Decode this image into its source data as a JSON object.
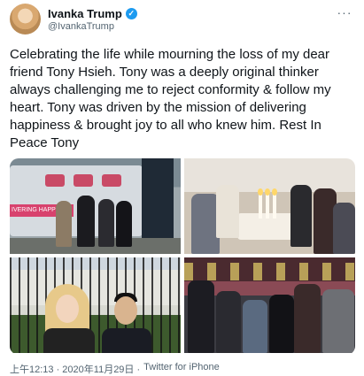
{
  "tweet": {
    "display_name": "Ivanka Trump",
    "verified_mark": "✓",
    "handle": "@IvankaTrump",
    "more_icon": "more-horizontal-icon",
    "text": "Celebrating the life while mourning the loss of my dear friend Tony Hsieh. Tony was a deeply original thinker always challenging me to reject conformity & follow my heart. Tony was driven by the mission of delivering happiness & brought joy to all who knew him. Rest In Peace Tony",
    "photos": [
      {
        "description_name": "photo-group-by-bus"
      },
      {
        "description_name": "photo-dinner-party"
      },
      {
        "description_name": "photo-white-house-fence"
      },
      {
        "description_name": "photo-group-restaurant"
      }
    ],
    "photo_bus_sign": "IVERING HAPP",
    "timestamp": "上午12:13 · 2020年11月29日 ·",
    "source": "Twitter for iPhone"
  },
  "colors": {
    "verified": "#1d9bf0",
    "secondary_text": "#536471",
    "primary_text": "#0f1419"
  }
}
